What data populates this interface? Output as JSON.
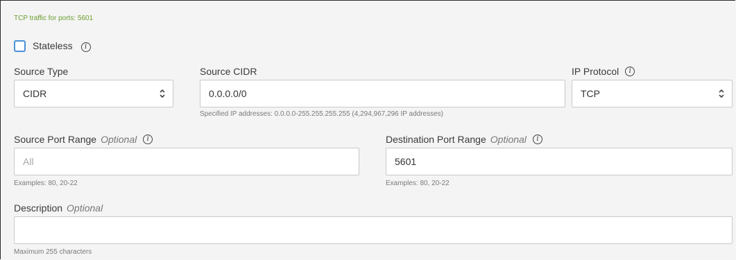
{
  "header": {
    "traffic_hint": "TCP traffic for ports: 5601"
  },
  "stateless": {
    "label": "Stateless",
    "checked": false,
    "info_icon": "info-icon"
  },
  "source_type": {
    "label": "Source Type",
    "selected": "CIDR"
  },
  "source_cidr": {
    "label": "Source CIDR",
    "value": "0.0.0.0/0",
    "help": "Specified IP addresses: 0.0.0.0-255.255.255.255 (4,294,967,296 IP addresses)"
  },
  "ip_protocol": {
    "label": "IP Protocol",
    "selected": "TCP"
  },
  "source_port_range": {
    "label": "Source Port Range",
    "optional": "Optional",
    "placeholder": "All",
    "help": "Examples: 80, 20-22"
  },
  "destination_port_range": {
    "label": "Destination Port Range",
    "optional": "Optional",
    "value": "5601",
    "help": "Examples: 80, 20-22"
  },
  "description": {
    "label": "Description",
    "optional": "Optional",
    "value": "",
    "help": "Maximum 255 characters"
  },
  "colors": {
    "checkbox_border": "#4a90d9",
    "hint_green": "#6a9e2f"
  }
}
